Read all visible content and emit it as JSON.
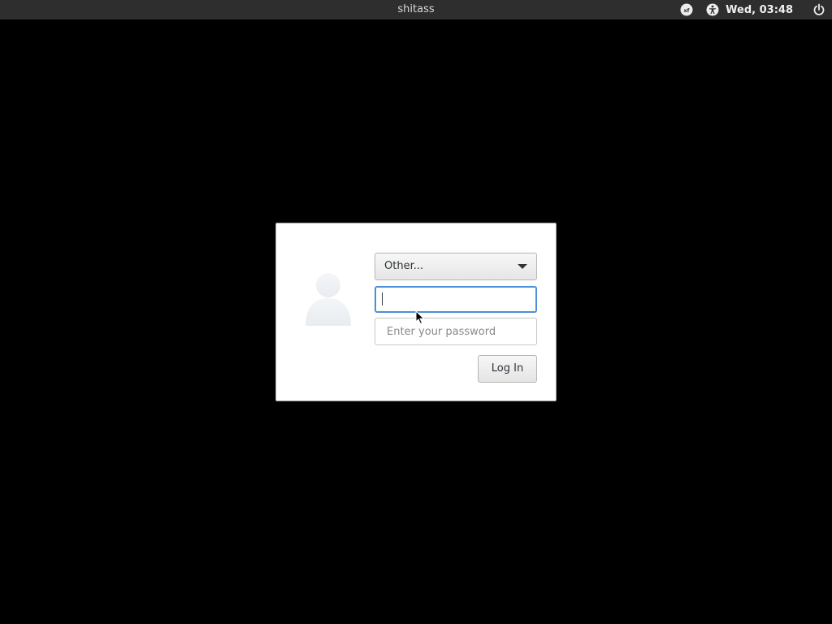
{
  "topbar": {
    "hostname": "shitass",
    "clock": "Wed, 03:48",
    "icons": [
      "keyboard-layout-icon",
      "accessibility-icon",
      "power-icon"
    ]
  },
  "login": {
    "user_select_value": "Other...",
    "username_value": "",
    "password_placeholder": "Enter your password",
    "login_button_label": "Log In"
  },
  "colors": {
    "desktop_background": "#000000",
    "topbar_background": "#2e2e2e",
    "focus_accent": "#4a90d9"
  }
}
